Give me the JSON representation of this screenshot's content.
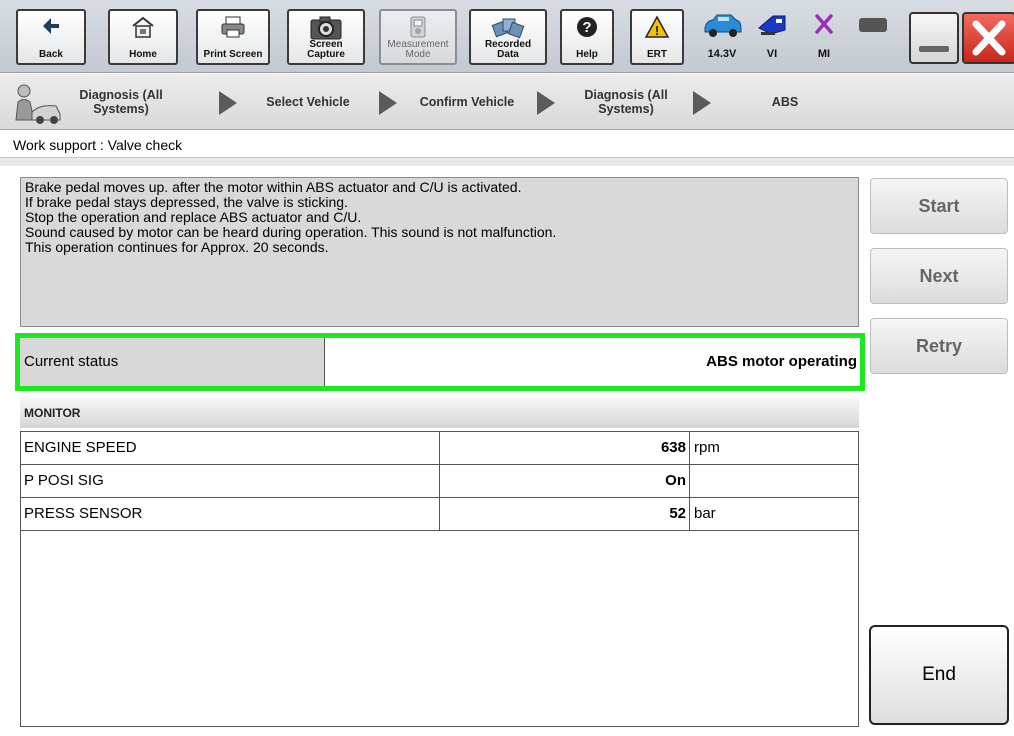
{
  "toolbar": {
    "back": "Back",
    "home": "Home",
    "print_screen": "Print Screen",
    "screen_capture": [
      "Screen",
      "Capture"
    ],
    "measurement_mode": [
      "Measurement",
      "Mode"
    ],
    "recorded_data": [
      "Recorded",
      "Data"
    ],
    "help": "Help",
    "ert": "ERT",
    "voltage": "14.3V",
    "vi": "VI",
    "mi": "MI"
  },
  "breadcrumb": {
    "step1": [
      "Diagnosis (All",
      "Systems)"
    ],
    "step2": "Select Vehicle",
    "step3": "Confirm Vehicle",
    "step4": [
      "Diagnosis (All",
      "Systems)"
    ],
    "step5": "ABS"
  },
  "page_title": "Work support : Valve check",
  "message_lines": [
    "Brake pedal moves up. after the motor within ABS actuator and C/U is activated.",
    "If brake pedal stays depressed, the valve is sticking.",
    "Stop the operation and replace ABS actuator and C/U.",
    "Sound caused by motor can be heard during operation. This sound is not malfunction.",
    "This operation continues for Approx. 20 seconds."
  ],
  "status": {
    "label": "Current status",
    "value": "ABS motor operating",
    "highlight_color": "#1ee81e"
  },
  "monitor": {
    "header": "MONITOR",
    "rows": [
      {
        "name": "ENGINE SPEED",
        "value": "638",
        "unit": "rpm"
      },
      {
        "name": "P POSI SIG",
        "value": "On",
        "unit": ""
      },
      {
        "name": "PRESS SENSOR",
        "value": "52",
        "unit": "bar"
      }
    ]
  },
  "buttons": {
    "start": "Start",
    "next": "Next",
    "retry": "Retry",
    "end": "End"
  }
}
